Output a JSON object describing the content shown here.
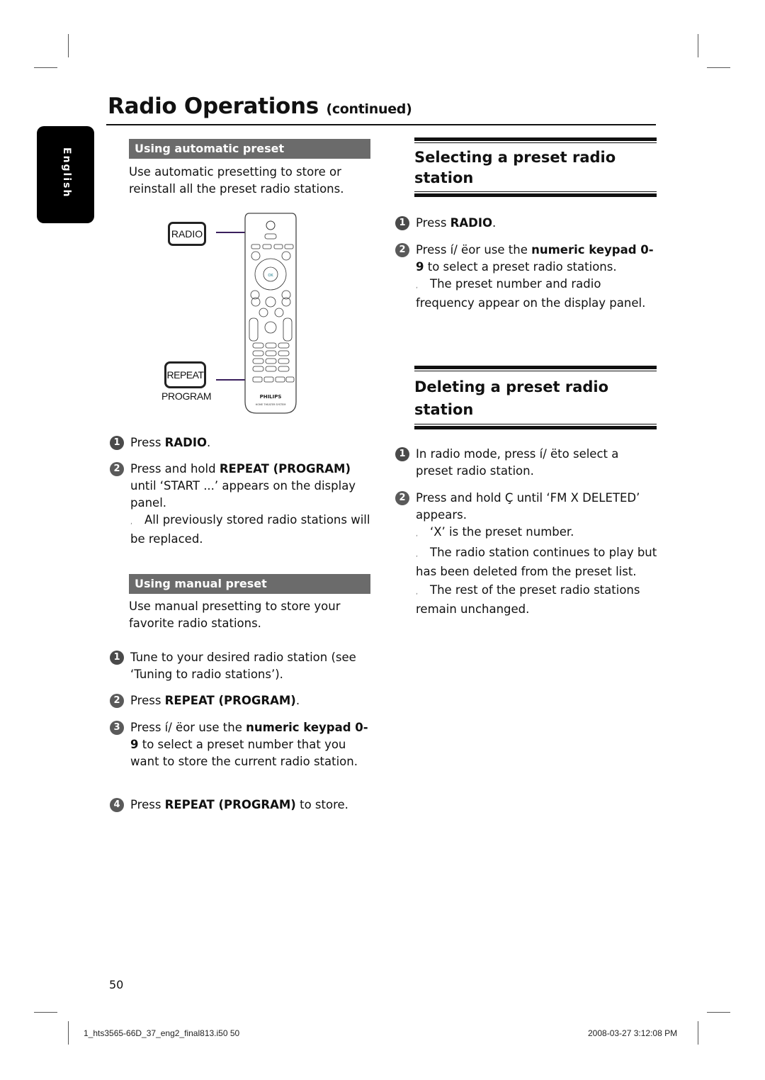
{
  "header": {
    "title": "Radio Operations",
    "title_suffix": "(continued)",
    "language_tab": "English"
  },
  "left_column": {
    "automatic_preset": {
      "heading": "Using automatic preset",
      "intro": "Use automatic presetting to store or reinstall all the preset radio stations.",
      "illustration": {
        "radio_button_label": "RADIO",
        "repeat_button_label": "REPEAT",
        "program_label": "PROGRAM",
        "remote_brand": "PHILIPS",
        "remote_subtitle": "HOME THEATER SYSTEM"
      },
      "steps": [
        {
          "num": "1",
          "pre": "Press ",
          "bold": "RADIO",
          "post": "."
        },
        {
          "num": "2",
          "pre": "Press and hold ",
          "bold": "REPEAT (PROGRAM)",
          "post": " until ‘START ...’ appears on the display panel.",
          "note": "All previously stored radio stations will be replaced."
        }
      ]
    },
    "manual_preset": {
      "heading": "Using manual preset",
      "intro": "Use manual presetting to store your favorite radio stations.",
      "steps": [
        {
          "num": "1",
          "text": "Tune to your desired radio station (see ‘Tuning to radio stations’)."
        },
        {
          "num": "2",
          "pre": "Press ",
          "bold": "REPEAT (PROGRAM)",
          "post": "."
        },
        {
          "num": "3",
          "pre": "Press í/ ëor use the ",
          "bold": "numeric keypad 0-9",
          "post": " to select a preset number that you want to store the current radio station."
        },
        {
          "num": "4",
          "pre": "Press ",
          "bold": "REPEAT (PROGRAM)",
          "post": " to store."
        }
      ]
    }
  },
  "right_column": {
    "selecting": {
      "heading": "Selecting a preset radio station",
      "steps": [
        {
          "num": "1",
          "pre": "Press ",
          "bold": "RADIO",
          "post": "."
        },
        {
          "num": "2",
          "pre": "Press í/ ëor use the ",
          "bold": "numeric keypad 0-9",
          "post": " to select a preset radio stations.",
          "note": "The preset number and radio frequency appear on the display panel."
        }
      ]
    },
    "deleting": {
      "heading": "Deleting a preset radio station",
      "steps": [
        {
          "num": "1",
          "text": "In radio mode, press í/ ëto select a preset radio station."
        },
        {
          "num": "2",
          "text": "Press and hold Ç   until ‘FM X DELETED’ appears.",
          "notes": [
            "‘X’ is the preset number.",
            "The radio station continues to play but has been deleted from the preset list.",
            "The rest of the preset radio stations remain unchanged."
          ]
        }
      ]
    }
  },
  "footer": {
    "page_number": "50",
    "file_info": "1_hts3565-66D_37_eng2_final813.i50   50",
    "timestamp": "2008-03-27   3:12:08 PM"
  }
}
